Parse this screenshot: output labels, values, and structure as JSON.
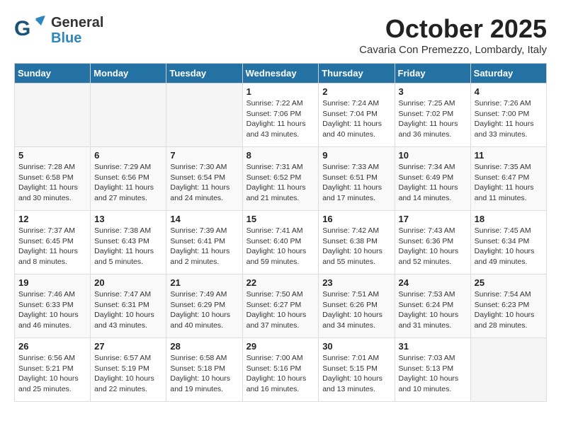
{
  "header": {
    "logo_general": "General",
    "logo_blue": "Blue",
    "month": "October 2025",
    "location": "Cavaria Con Premezzo, Lombardy, Italy"
  },
  "days_of_week": [
    "Sunday",
    "Monday",
    "Tuesday",
    "Wednesday",
    "Thursday",
    "Friday",
    "Saturday"
  ],
  "weeks": [
    [
      {
        "day": "",
        "info": ""
      },
      {
        "day": "",
        "info": ""
      },
      {
        "day": "",
        "info": ""
      },
      {
        "day": "1",
        "info": "Sunrise: 7:22 AM\nSunset: 7:06 PM\nDaylight: 11 hours\nand 43 minutes."
      },
      {
        "day": "2",
        "info": "Sunrise: 7:24 AM\nSunset: 7:04 PM\nDaylight: 11 hours\nand 40 minutes."
      },
      {
        "day": "3",
        "info": "Sunrise: 7:25 AM\nSunset: 7:02 PM\nDaylight: 11 hours\nand 36 minutes."
      },
      {
        "day": "4",
        "info": "Sunrise: 7:26 AM\nSunset: 7:00 PM\nDaylight: 11 hours\nand 33 minutes."
      }
    ],
    [
      {
        "day": "5",
        "info": "Sunrise: 7:28 AM\nSunset: 6:58 PM\nDaylight: 11 hours\nand 30 minutes."
      },
      {
        "day": "6",
        "info": "Sunrise: 7:29 AM\nSunset: 6:56 PM\nDaylight: 11 hours\nand 27 minutes."
      },
      {
        "day": "7",
        "info": "Sunrise: 7:30 AM\nSunset: 6:54 PM\nDaylight: 11 hours\nand 24 minutes."
      },
      {
        "day": "8",
        "info": "Sunrise: 7:31 AM\nSunset: 6:52 PM\nDaylight: 11 hours\nand 21 minutes."
      },
      {
        "day": "9",
        "info": "Sunrise: 7:33 AM\nSunset: 6:51 PM\nDaylight: 11 hours\nand 17 minutes."
      },
      {
        "day": "10",
        "info": "Sunrise: 7:34 AM\nSunset: 6:49 PM\nDaylight: 11 hours\nand 14 minutes."
      },
      {
        "day": "11",
        "info": "Sunrise: 7:35 AM\nSunset: 6:47 PM\nDaylight: 11 hours\nand 11 minutes."
      }
    ],
    [
      {
        "day": "12",
        "info": "Sunrise: 7:37 AM\nSunset: 6:45 PM\nDaylight: 11 hours\nand 8 minutes."
      },
      {
        "day": "13",
        "info": "Sunrise: 7:38 AM\nSunset: 6:43 PM\nDaylight: 11 hours\nand 5 minutes."
      },
      {
        "day": "14",
        "info": "Sunrise: 7:39 AM\nSunset: 6:41 PM\nDaylight: 11 hours\nand 2 minutes."
      },
      {
        "day": "15",
        "info": "Sunrise: 7:41 AM\nSunset: 6:40 PM\nDaylight: 10 hours\nand 59 minutes."
      },
      {
        "day": "16",
        "info": "Sunrise: 7:42 AM\nSunset: 6:38 PM\nDaylight: 10 hours\nand 55 minutes."
      },
      {
        "day": "17",
        "info": "Sunrise: 7:43 AM\nSunset: 6:36 PM\nDaylight: 10 hours\nand 52 minutes."
      },
      {
        "day": "18",
        "info": "Sunrise: 7:45 AM\nSunset: 6:34 PM\nDaylight: 10 hours\nand 49 minutes."
      }
    ],
    [
      {
        "day": "19",
        "info": "Sunrise: 7:46 AM\nSunset: 6:33 PM\nDaylight: 10 hours\nand 46 minutes."
      },
      {
        "day": "20",
        "info": "Sunrise: 7:47 AM\nSunset: 6:31 PM\nDaylight: 10 hours\nand 43 minutes."
      },
      {
        "day": "21",
        "info": "Sunrise: 7:49 AM\nSunset: 6:29 PM\nDaylight: 10 hours\nand 40 minutes."
      },
      {
        "day": "22",
        "info": "Sunrise: 7:50 AM\nSunset: 6:27 PM\nDaylight: 10 hours\nand 37 minutes."
      },
      {
        "day": "23",
        "info": "Sunrise: 7:51 AM\nSunset: 6:26 PM\nDaylight: 10 hours\nand 34 minutes."
      },
      {
        "day": "24",
        "info": "Sunrise: 7:53 AM\nSunset: 6:24 PM\nDaylight: 10 hours\nand 31 minutes."
      },
      {
        "day": "25",
        "info": "Sunrise: 7:54 AM\nSunset: 6:23 PM\nDaylight: 10 hours\nand 28 minutes."
      }
    ],
    [
      {
        "day": "26",
        "info": "Sunrise: 6:56 AM\nSunset: 5:21 PM\nDaylight: 10 hours\nand 25 minutes."
      },
      {
        "day": "27",
        "info": "Sunrise: 6:57 AM\nSunset: 5:19 PM\nDaylight: 10 hours\nand 22 minutes."
      },
      {
        "day": "28",
        "info": "Sunrise: 6:58 AM\nSunset: 5:18 PM\nDaylight: 10 hours\nand 19 minutes."
      },
      {
        "day": "29",
        "info": "Sunrise: 7:00 AM\nSunset: 5:16 PM\nDaylight: 10 hours\nand 16 minutes."
      },
      {
        "day": "30",
        "info": "Sunrise: 7:01 AM\nSunset: 5:15 PM\nDaylight: 10 hours\nand 13 minutes."
      },
      {
        "day": "31",
        "info": "Sunrise: 7:03 AM\nSunset: 5:13 PM\nDaylight: 10 hours\nand 10 minutes."
      },
      {
        "day": "",
        "info": ""
      }
    ]
  ]
}
